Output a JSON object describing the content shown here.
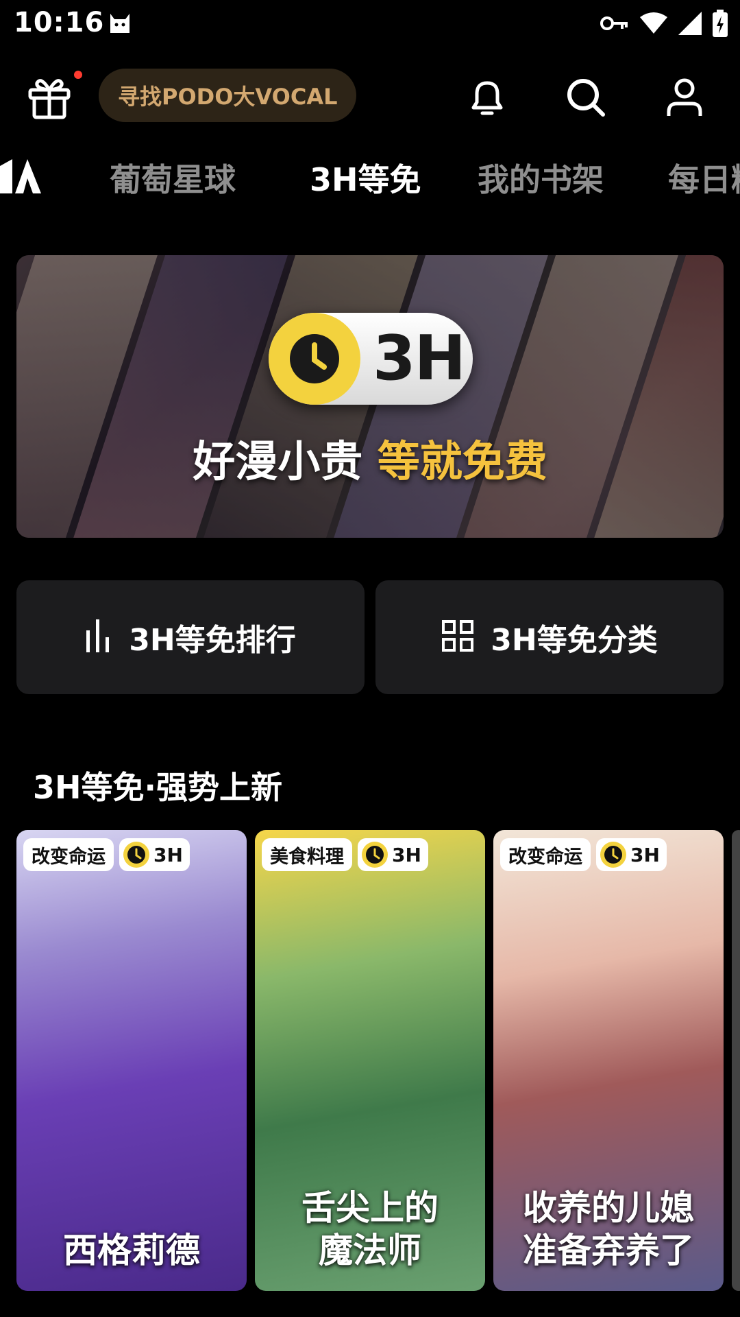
{
  "status_bar": {
    "time": "10:16"
  },
  "top_bar": {
    "search_placeholder": "寻找PODO大VOCAL"
  },
  "tabs": [
    {
      "label": "葡萄星球",
      "active": false
    },
    {
      "label": "3H等免",
      "active": true
    },
    {
      "label": "我的书架",
      "active": false
    },
    {
      "label": "每日精",
      "active": false
    }
  ],
  "banner": {
    "badge": "3H",
    "slogan_main": "好漫小贵 ",
    "slogan_highlight": "等就免费"
  },
  "quick_buttons": {
    "ranking_label": "3H等免排行",
    "category_label": "3H等免分类"
  },
  "section": {
    "title": "3H等免·强势上新"
  },
  "cards": [
    {
      "tag": "改变命运",
      "badge": "3H",
      "title": "西格莉德",
      "accent": "#6a3fb5"
    },
    {
      "tag": "美食料理",
      "badge": "3H",
      "title": "舌尖上的\n魔法师",
      "accent": "#3f7a4a"
    },
    {
      "tag": "改变命运",
      "badge": "3H",
      "title": "收养的儿媳\n准备弃养了",
      "accent": "#a05a5a"
    }
  ],
  "colors": {
    "accent_gold": "#f5c23e",
    "pill_text": "#d3a870",
    "badge_yellow": "#f3d23e"
  }
}
